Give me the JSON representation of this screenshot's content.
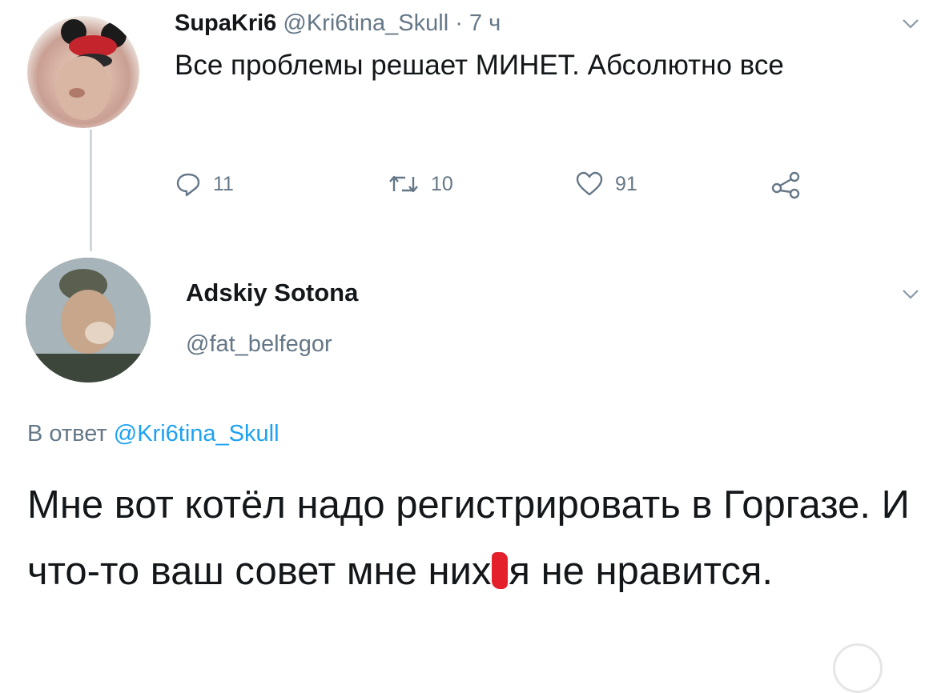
{
  "tweet1": {
    "display_name": "SupaKri6",
    "handle": "@Kri6tina_Skull",
    "separator": "·",
    "time": "7 ч",
    "text": "Все проблемы решает МИНЕТ. Абсолютно все",
    "actions": {
      "replies": "11",
      "retweets": "10",
      "likes": "91"
    }
  },
  "tweet2": {
    "display_name": "Adskiy Sotona",
    "handle": "@fat_belfegor",
    "reply_prefix": "В ответ",
    "reply_handle": "@Kri6tina_Skull",
    "text_part1": "Мне вот котёл надо регистрировать в Горгазе. И что-то ваш совет мне них",
    "text_part2": "я не нравится."
  },
  "icons": {
    "reply": "reply-icon",
    "retweet": "retweet-icon",
    "like": "heart-icon",
    "share": "share-icon",
    "menu": "chevron-down-icon"
  },
  "colors": {
    "text": "#14171a",
    "muted": "#657786",
    "link": "#1da1f2",
    "censor": "#e3202b"
  }
}
